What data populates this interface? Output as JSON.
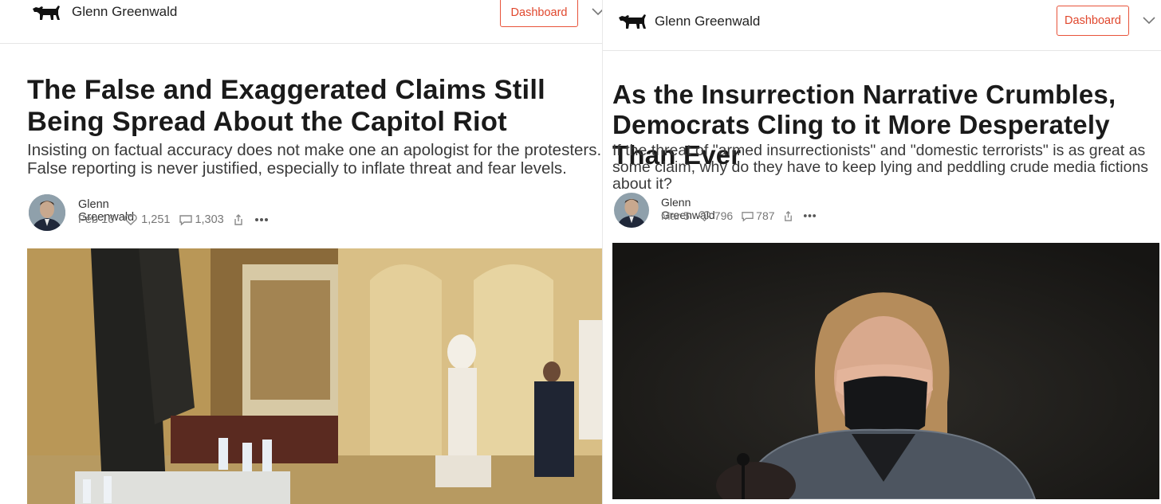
{
  "left": {
    "publication": "Glenn Greenwald",
    "dashboard_label": "Dashboard",
    "title": "The False and Exaggerated Claims Still Being Spread About the Capitol Riot",
    "subtitle": "Insisting on factual accuracy does not make one an apologist for the protesters. False reporting is never justified, especially to inflate threat and fear levels.",
    "author": "Glenn Greenwald",
    "date": "Feb 16",
    "likes": "1,251",
    "comments": "1,303"
  },
  "right": {
    "publication": "Glenn Greenwald",
    "dashboard_label": "Dashboard",
    "title": "As the Insurrection Narrative Crumbles, Democrats Cling to it More Desperately Than Ever",
    "subtitle": "If the threat of \"armed insurrectionists\" and \"domestic terrorists\" is as great as some claim, why do they have to keep lying and peddling crude media fictions about it?",
    "author": "Glenn Greenwald",
    "date": "Mar 5",
    "likes": "796",
    "comments": "787"
  },
  "icons": {
    "logo": "dog-logo-icon",
    "dropdown": "chevron-down-icon",
    "like": "heart-icon",
    "comment": "comment-icon",
    "share": "share-icon",
    "more": "more-icon"
  },
  "colors": {
    "accent": "#e0472d",
    "text": "#1a1a1a",
    "muted": "#777777"
  }
}
